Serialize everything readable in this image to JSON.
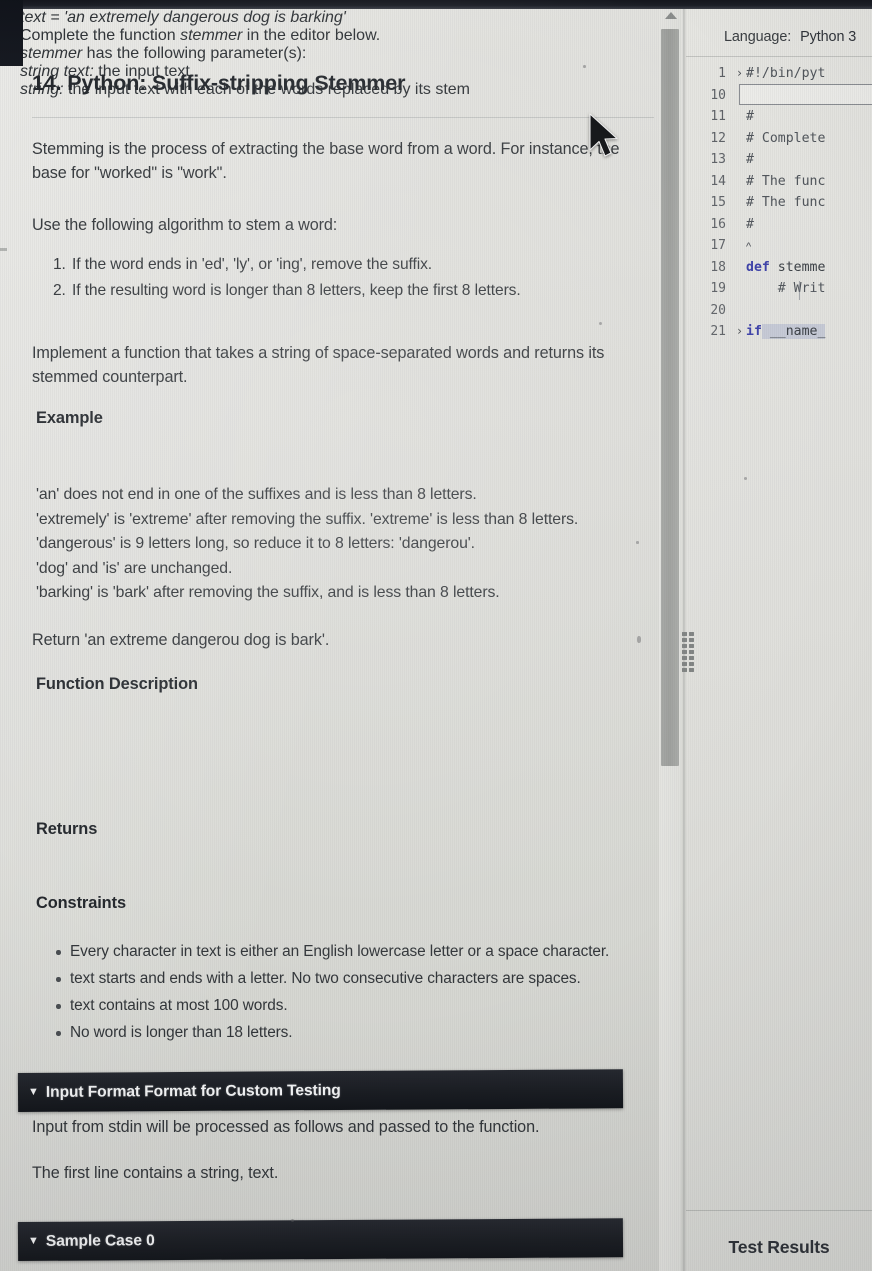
{
  "problem": {
    "title": "14. Python: Suffix-stripping Stemmer",
    "intro": "Stemming is the process of extracting the base word from a word. For instance, the base for \"worked\" is \"work\".",
    "algorithm_lead": "Use the following algorithm to stem a word:",
    "steps": [
      "If the word ends in 'ed', 'ly', or 'ing', remove the suffix.",
      "If the resulting word is longer than 8 letters, keep the first 8 letters."
    ],
    "implement": "Implement a function that takes a string of space-separated words and returns its stemmed counterpart.",
    "example_heading": "Example",
    "example_assign_label": "text = ",
    "example_assign_value": "'an extremely dangerous dog is barking'",
    "example_lines": [
      "'an' does not end in one of the suffixes and is less than 8 letters.",
      "'extremely' is 'extreme' after removing the suffix. 'extreme' is less than 8 letters.",
      "'dangerous' is 9 letters long, so reduce it to 8 letters: 'dangerou'.",
      "'dog' and 'is' are unchanged.",
      "'barking' is 'bark' after removing the suffix, and is less than 8 letters."
    ],
    "return_line": "Return 'an extreme dangerou dog is bark'.",
    "function_description_heading": "Function Description",
    "function_description_pre": "Complete the function ",
    "function_description_name": "stemmer",
    "function_description_post": " in the editor below.",
    "params_lead_name": "stemmer",
    "params_lead_rest": " has the following parameter(s):",
    "param_name": "string text:",
    "param_desc": " the input text",
    "returns_heading": "Returns",
    "returns_name": "string:",
    "returns_desc": " the input text with each of the words replaced by its stem",
    "constraints_heading": "Constraints",
    "constraints": [
      "Every character in text is either an English lowercase letter or a space character.",
      "text starts and ends with a letter. No two consecutive characters are spaces.",
      "text contains at most 100 words.",
      "No word is longer than 18 letters."
    ],
    "input_format_bar": "Input Format Format for Custom Testing",
    "input_format_body_1": "Input from stdin will be processed as follows and passed to the function.",
    "input_format_body_2": "The first line contains a string, text.",
    "sample_case_bar": "Sample Case 0",
    "caret_glyph": "▼"
  },
  "editor": {
    "language_label": "Language:",
    "language_value": "Python 3",
    "lines": [
      {
        "num": "1",
        "fold": "›",
        "text": "#!/bin/pyt"
      },
      {
        "num": "10",
        "fold": "",
        "text": ""
      },
      {
        "num": "11",
        "fold": "",
        "text": "#"
      },
      {
        "num": "12",
        "fold": "",
        "text": "# Complete"
      },
      {
        "num": "13",
        "fold": "",
        "text": "#"
      },
      {
        "num": "14",
        "fold": "",
        "text": "# The func"
      },
      {
        "num": "15",
        "fold": "",
        "text": "# The func"
      },
      {
        "num": "16",
        "fold": "",
        "text": "#"
      },
      {
        "num": "17",
        "fold": "",
        "text": ""
      },
      {
        "num": "18",
        "fold": "",
        "text": "def stemme"
      },
      {
        "num": "19",
        "fold": "",
        "text": "    # Writ"
      },
      {
        "num": "20",
        "fold": "",
        "text": ""
      },
      {
        "num": "21",
        "fold": "›",
        "text": "if __name_"
      }
    ]
  },
  "results": {
    "title": "Test Results"
  },
  "scrollbar": {
    "arrow_glyph": "▲"
  },
  "colors": {
    "page_bg": "#dcdcd8",
    "dark_bar": "#191c22",
    "text": "#32363a",
    "keyword": "#3b3fa8",
    "scroll_thumb": "#9b9d9a"
  }
}
